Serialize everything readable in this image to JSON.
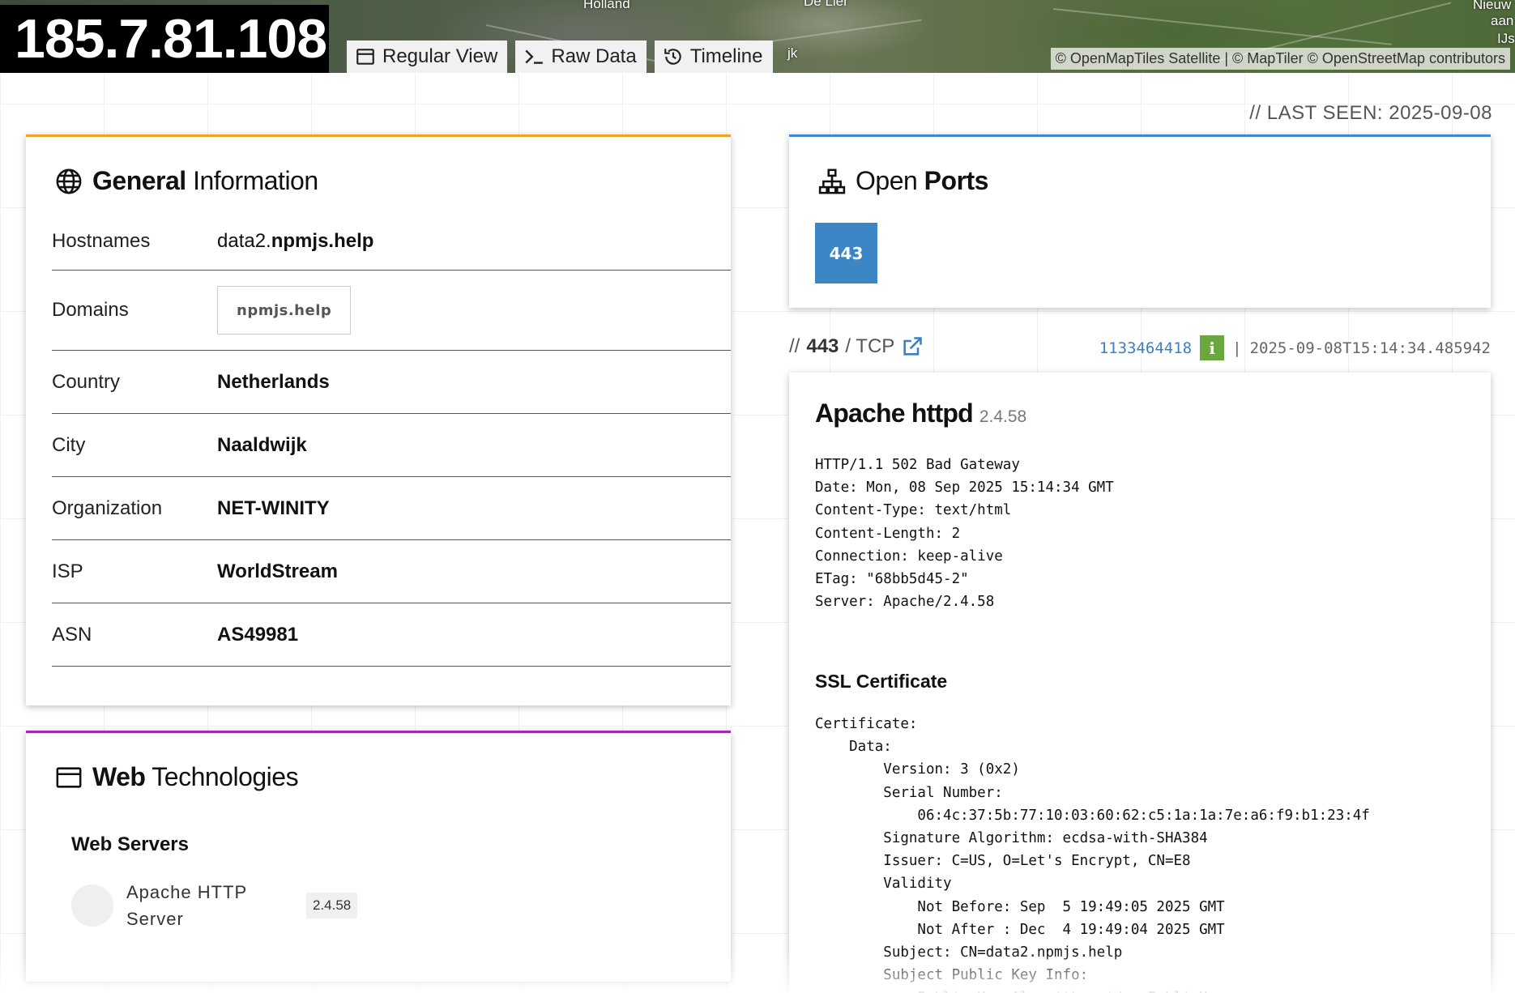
{
  "header": {
    "ip": "185.7.81.108",
    "tabs": [
      {
        "label": "Regular View",
        "icon": "window-icon"
      },
      {
        "label": "Raw Data",
        "icon": "terminal-icon"
      },
      {
        "label": "Timeline",
        "icon": "history-icon"
      }
    ],
    "map": {
      "labels": [
        "Holland",
        "De Lier",
        "Nieuw",
        "aan",
        "IJs",
        "jk"
      ],
      "attribution": "© OpenMapTiles Satellite | © MapTiler © OpenStreetMap contributors"
    }
  },
  "last_seen": "// LAST SEEN: 2025-09-08",
  "general": {
    "title_bold": "General",
    "title_rest": "Information",
    "rows": [
      {
        "label": "Hostnames",
        "value_prefix": "data2.",
        "value_bold": "npmjs.help"
      },
      {
        "label": "Domains",
        "chip": "npmjs.help"
      },
      {
        "label": "Country",
        "value": "Netherlands"
      },
      {
        "label": "City",
        "value": "Naaldwijk"
      },
      {
        "label": "Organization",
        "value": "NET-WINITY"
      },
      {
        "label": "ISP",
        "value": "WorldStream"
      },
      {
        "label": "ASN",
        "value": "AS49981"
      }
    ]
  },
  "webtech": {
    "title_bold": "Web",
    "title_rest": "Technologies",
    "section": "Web Servers",
    "item": {
      "name": "Apache HTTP Server",
      "version": "2.4.58"
    }
  },
  "ports": {
    "title_light": "Open",
    "title_bold": "Ports",
    "list": [
      "443"
    ]
  },
  "port_detail": {
    "prefix": "//",
    "port": "443",
    "protocol": "/ TCP",
    "hash": "1133464418",
    "info_label": "i",
    "separator": "|",
    "timestamp": "2025-09-08T15:14:34.485942",
    "product": "Apache httpd",
    "version": "2.4.58",
    "http_banner": "HTTP/1.1 502 Bad Gateway\nDate: Mon, 08 Sep 2025 15:14:34 GMT\nContent-Type: text/html\nContent-Length: 2\nConnection: keep-alive\nETag: \"68bb5d45-2\"\nServer: Apache/2.4.58",
    "ssl_title": "SSL Certificate",
    "ssl_text": "Certificate:\n    Data:\n        Version: 3 (0x2)\n        Serial Number:\n            06:4c:37:5b:77:10:03:60:62:c5:1a:1a:7e:a6:f9:b1:23:4f\n        Signature Algorithm: ecdsa-with-SHA384\n        Issuer: C=US, O=Let's Encrypt, CN=E8\n        Validity\n            Not Before: Sep  5 19:49:05 2025 GMT\n            Not After : Dec  4 19:49:04 2025 GMT\n        Subject: CN=data2.npmjs.help\n        Subject Public Key Info:\n            Public Key Algorithm: id-ecPublicKey"
  },
  "colors": {
    "general_accent": "#f0a326",
    "webtech_accent": "#a02bb1",
    "ports_accent": "#3d8ad0",
    "port_badge": "#3d86c6",
    "info_button": "#6aa83f",
    "link": "#3d7fc4"
  }
}
